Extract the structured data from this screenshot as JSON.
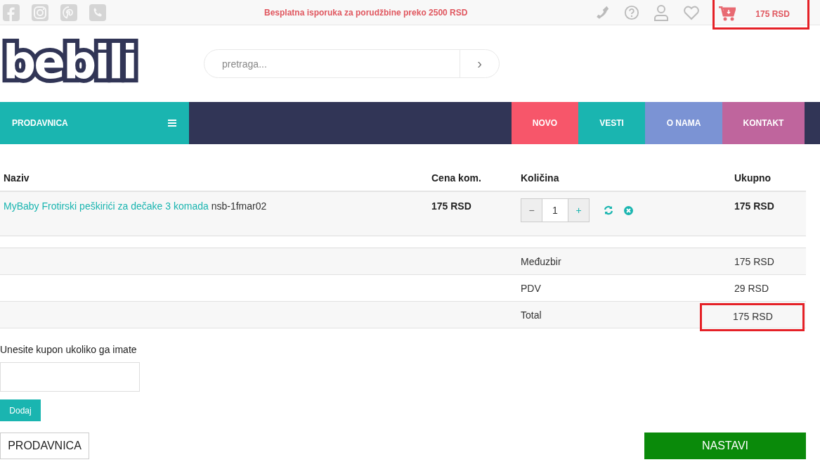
{
  "top_bar": {
    "shipping_note": "Besplatna isporuka za porudžbine preko 2500 RSD",
    "cart_total": "175 RSD",
    "cart_highlighted": true
  },
  "logo": {
    "text": "bebili"
  },
  "search": {
    "placeholder": "pretraga...",
    "button": "›"
  },
  "nav": {
    "shop_label": "PRODAVNICA",
    "items": [
      {
        "label": "NOVO",
        "color": "#f7566a"
      },
      {
        "label": "VESTI",
        "color": "#1ab5b0"
      },
      {
        "label": "O NAMA",
        "color": "#7b93d4"
      },
      {
        "label": "KONTAKT",
        "color": "#bf659d"
      }
    ]
  },
  "cart": {
    "columns": [
      "Naziv",
      "Cena kom.",
      "Količina",
      "Ukupno"
    ],
    "items": [
      {
        "name": "MyBaby Frotirski peškirići za dečake 3 komada",
        "code": "nsb-1fmar02",
        "price": "175 RSD",
        "decrement": "−",
        "quantity": "1",
        "increment": "+",
        "total": "175 RSD"
      }
    ],
    "summary": [
      {
        "label": "Međuzbir",
        "value": "175 RSD",
        "highlighted": false
      },
      {
        "label": "PDV",
        "value": "29 RSD",
        "highlighted": false
      },
      {
        "label": "Total",
        "value": "175 RSD",
        "highlighted": true
      }
    ]
  },
  "coupon": {
    "label": "Unesite kupon ukoliko ga imate",
    "button": "Dodaj"
  },
  "buttons": {
    "back": "PRODAVNICA",
    "continue": "NASTAVI"
  }
}
